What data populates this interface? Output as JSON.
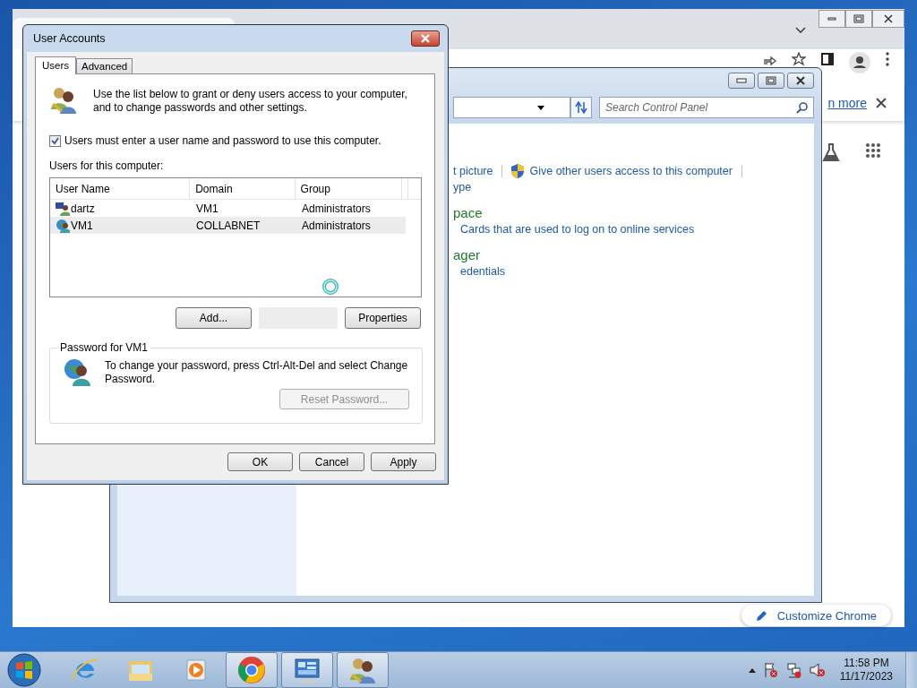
{
  "browser": {
    "infobar_link": "n more",
    "customize_button": "Customize Chrome"
  },
  "control_panel": {
    "search": {
      "placeholder": "Search Control Panel"
    },
    "task_links": [
      {
        "kind": "plain",
        "text": "t picture"
      },
      {
        "kind": "shield",
        "text": "Give other users access to this computer"
      }
    ],
    "task_link_second_line": "ype",
    "sections": [
      {
        "heading": "pace",
        "link": "Cards that are used to log on to online services"
      },
      {
        "heading": "ager",
        "link": "edentials"
      }
    ]
  },
  "dialog": {
    "title": "User Accounts",
    "tabs": [
      {
        "label": "Users",
        "selected": true
      },
      {
        "label": "Advanced",
        "selected": false
      }
    ],
    "intro": "Use the list below to grant or deny users access to your computer, and to change passwords and other settings.",
    "require_login": {
      "label": "Users must enter a user name and password to use this computer.",
      "checked": true
    },
    "list_label": "Users for this computer:",
    "columns": [
      "User Name",
      "Domain",
      "Group"
    ],
    "rows": [
      {
        "kind": "local",
        "cells": [
          "dartz",
          "VM1",
          "Administrators"
        ],
        "selected": false
      },
      {
        "kind": "domain",
        "cells": [
          "VM1",
          "COLLABNET",
          "Administrators"
        ],
        "selected": true
      }
    ],
    "list_buttons": [
      {
        "label": "Add...",
        "disabled": false
      },
      {
        "label": "Properties",
        "disabled": false
      }
    ],
    "password_group": {
      "title": "Password for VM1",
      "text": "To change your password, press Ctrl-Alt-Del and select Change Password.",
      "button": {
        "label": "Reset Password...",
        "disabled": true
      }
    },
    "footer_buttons": [
      "OK",
      "Cancel",
      "Apply"
    ]
  },
  "taskbar": {
    "items": [
      {
        "kind": "ie",
        "running": false
      },
      {
        "kind": "explorer",
        "running": false
      },
      {
        "kind": "media",
        "running": false
      },
      {
        "kind": "chrome",
        "running": true
      },
      {
        "kind": "control-panel",
        "running": true
      },
      {
        "kind": "users",
        "running": true
      }
    ],
    "clock": {
      "time": "11:58 PM",
      "date": "11/17/2023"
    }
  }
}
